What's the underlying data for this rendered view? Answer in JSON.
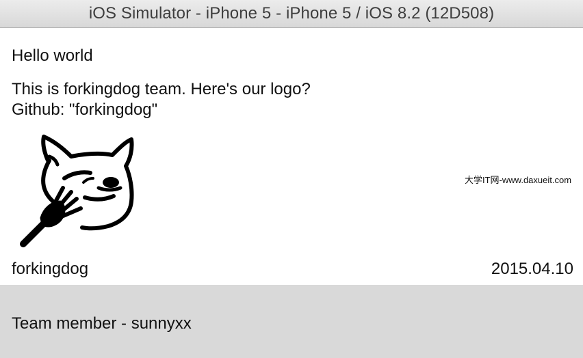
{
  "window": {
    "title": "iOS Simulator - iPhone 5 - iPhone 5 / iOS 8.2 (12D508)"
  },
  "feed": {
    "cells": [
      {
        "title": "Hello world",
        "content": "This is forkingdog team. Here's our logo?\nGithub: \"forkingdog\"",
        "image_icon": "forkingdog-logo",
        "username": "forkingdog",
        "time": "2015.04.10",
        "background": "#ffffff"
      },
      {
        "title": "Team member - sunnyxx",
        "background": "#d9d9d9"
      }
    ]
  },
  "watermark": {
    "text": "大学IT网-www.daxueit.com"
  }
}
